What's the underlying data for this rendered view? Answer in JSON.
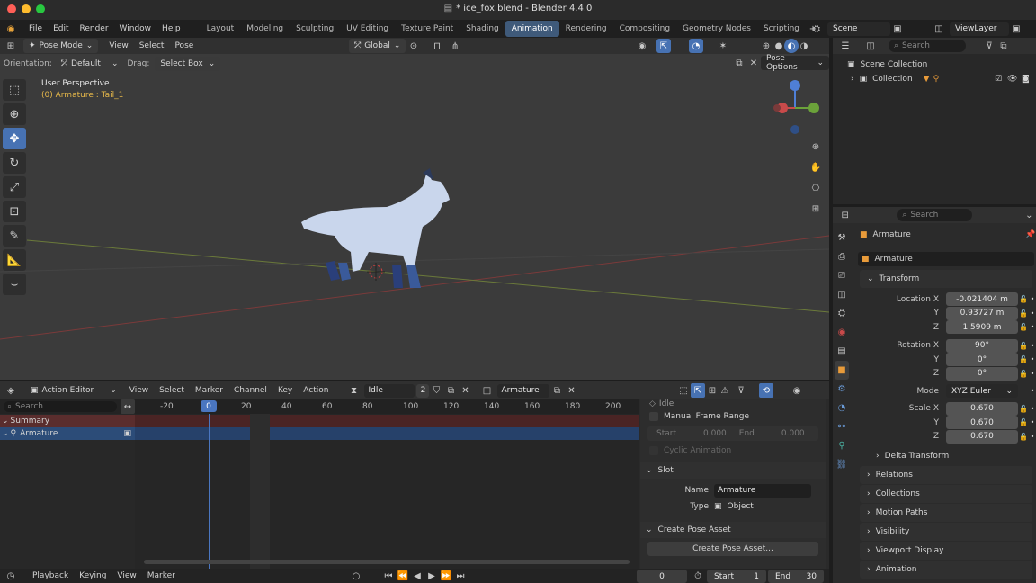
{
  "window": {
    "title": "* ice_fox.blend - Blender 4.4.0"
  },
  "menus": [
    "File",
    "Edit",
    "Render",
    "Window",
    "Help"
  ],
  "workspaces": [
    "Layout",
    "Modeling",
    "Sculpting",
    "UV Editing",
    "Texture Paint",
    "Shading",
    "Animation",
    "Rendering",
    "Compositing",
    "Geometry Nodes",
    "Scripting"
  ],
  "active_workspace": "Animation",
  "scene": "Scene",
  "viewlayer": "ViewLayer",
  "search_placeholder": "Search",
  "viewport": {
    "mode": "Pose Mode",
    "menus": [
      "View",
      "Select",
      "Pose"
    ],
    "orientation_label": "Orientation:",
    "orientation": "Default",
    "drag_label": "Drag:",
    "drag": "Select Box",
    "transform": "Global",
    "pose_options": "Pose Options",
    "perspective": "User Perspective",
    "context": "(0) Armature : Tail_1"
  },
  "outliner": {
    "scene_collection": "Scene Collection",
    "collection": "Collection"
  },
  "properties": {
    "object": "Armature",
    "data": "Armature",
    "transform": "Transform",
    "location": {
      "label": "Location X",
      "x": "-0.021404 m",
      "y": "0.93727 m",
      "z": "1.5909 m"
    },
    "rotation": {
      "label": "Rotation X",
      "x": "90°",
      "y": "0°",
      "z": "0°"
    },
    "mode_label": "Mode",
    "mode": "XYZ Euler",
    "scale": {
      "label": "Scale X",
      "x": "0.670",
      "y": "0.670",
      "z": "0.670"
    },
    "axis_y": "Y",
    "axis_z": "Z",
    "sections": [
      "Delta Transform",
      "Relations",
      "Collections",
      "Motion Paths",
      "Visibility",
      "Viewport Display",
      "Animation"
    ]
  },
  "action_editor": {
    "editor": "Action Editor",
    "menus": [
      "View",
      "Select",
      "Marker",
      "Channel",
      "Key",
      "Action"
    ],
    "action": "Idle",
    "users": "2",
    "slot_object": "Armature",
    "frames": [
      "-20",
      "0",
      "20",
      "40",
      "60",
      "80",
      "100",
      "120",
      "140",
      "160",
      "180",
      "200"
    ],
    "current": "0",
    "channels": [
      "Summary",
      "Armature"
    ],
    "side": {
      "idle": "Idle",
      "manual_range": "Manual Frame Range",
      "start_label": "Start",
      "start": "0.000",
      "end_label": "End",
      "end": "0.000",
      "cyclic": "Cyclic Animation",
      "slot": "Slot",
      "name_label": "Name",
      "name": "Armature",
      "type_label": "Type",
      "type": "Object",
      "pose_asset": "Create Pose Asset",
      "pose_asset_btn": "Create Pose Asset..."
    }
  },
  "timeline": {
    "menus": [
      "Playback",
      "Keying",
      "View",
      "Marker"
    ],
    "frame": "0",
    "start_label": "Start",
    "start": "1",
    "end_label": "End",
    "end": "30"
  }
}
